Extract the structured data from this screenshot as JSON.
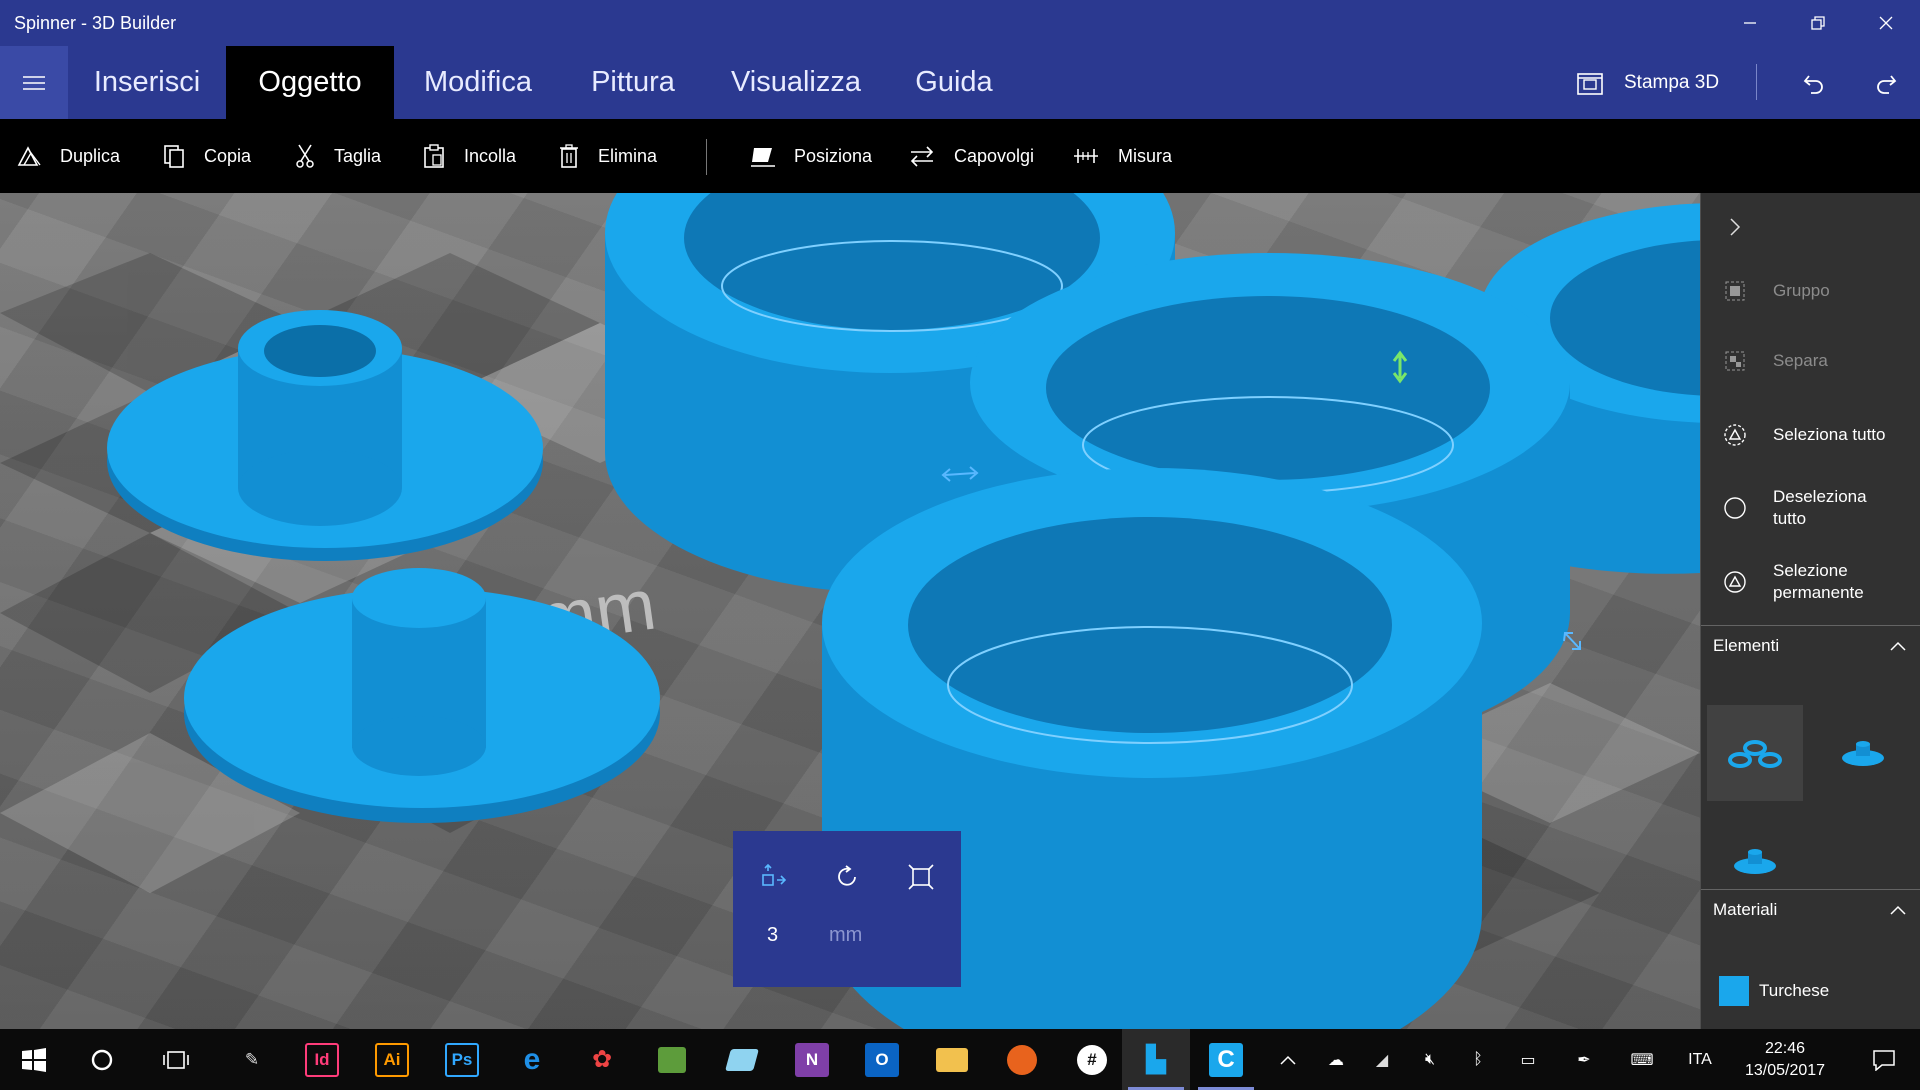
{
  "window": {
    "title": "Spinner - 3D Builder",
    "minimize_icon": "minimize-icon",
    "maximize_icon": "restore-icon",
    "close_icon": "close-icon"
  },
  "menu": {
    "tabs": [
      {
        "label": "Inserisci"
      },
      {
        "label": "Oggetto"
      },
      {
        "label": "Modifica"
      },
      {
        "label": "Pittura"
      },
      {
        "label": "Visualizza"
      },
      {
        "label": "Guida"
      }
    ],
    "active_tab": "Oggetto",
    "print_label": "Stampa 3D"
  },
  "toolbar": {
    "items": [
      {
        "label": "Duplica",
        "icon": "duplicate-icon"
      },
      {
        "label": "Copia",
        "icon": "copy-icon"
      },
      {
        "label": "Taglia",
        "icon": "scissors-icon"
      },
      {
        "label": "Incolla",
        "icon": "paste-icon"
      },
      {
        "label": "Elimina",
        "icon": "trash-icon"
      },
      {
        "label": "Posiziona",
        "icon": "place-icon"
      },
      {
        "label": "Capovolgi",
        "icon": "flip-icon"
      },
      {
        "label": "Misura",
        "icon": "ruler-icon"
      }
    ]
  },
  "viewport": {
    "floor_label": "0 mm"
  },
  "right_panel": {
    "items": [
      {
        "label": "Gruppo",
        "enabled": false
      },
      {
        "label": "Separa",
        "enabled": false
      },
      {
        "label": "Seleziona tutto",
        "enabled": true
      },
      {
        "label": "Deseleziona tutto",
        "enabled": true
      },
      {
        "label": "Selezione permanente",
        "enabled": true
      }
    ],
    "elements_title": "Elementi",
    "materials_title": "Materiali",
    "material": {
      "name": "Turchese",
      "color": "#1aa7ec"
    }
  },
  "move_panel": {
    "value": "3",
    "unit": "mm"
  },
  "taskbar": {
    "language": "ITA",
    "time": "22:46",
    "date": "13/05/2017"
  },
  "colors": {
    "accent": "#2b3990",
    "model": "#1aa7ec"
  }
}
